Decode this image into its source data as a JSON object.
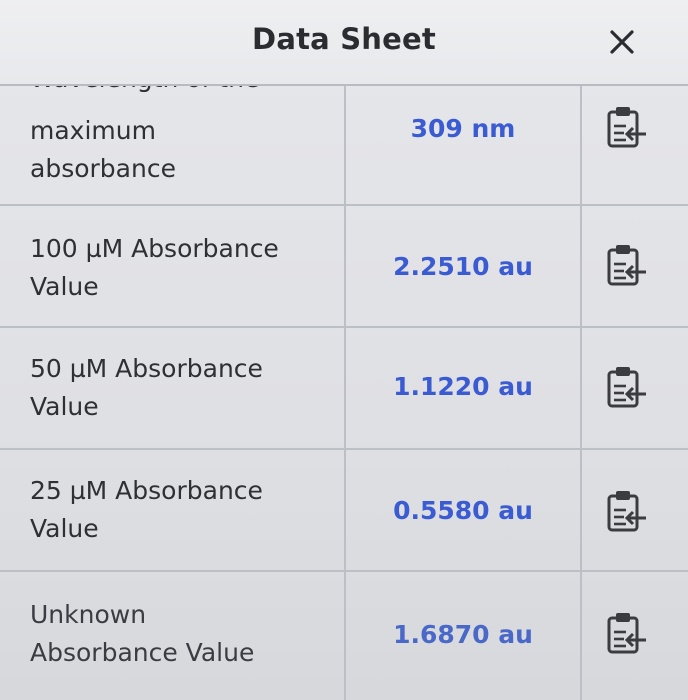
{
  "header": {
    "title": "Data Sheet",
    "close_icon": "close-x-icon"
  },
  "rows": [
    {
      "label_partial": "Wavelength of the",
      "label_line1": "maximum",
      "label_line2": "absorbance",
      "value": "309 nm",
      "icon": "copy-to-clipboard-icon"
    },
    {
      "label_line1": "100 µM Absorbance",
      "label_line2": "Value",
      "value": "2.2510 au",
      "icon": "copy-to-clipboard-icon"
    },
    {
      "label_line1": "50 µM Absorbance",
      "label_line2": "Value",
      "value": "1.1220 au",
      "icon": "copy-to-clipboard-icon"
    },
    {
      "label_line1": "25 µM Absorbance",
      "label_line2": "Value",
      "value": "0.5580 au",
      "icon": "copy-to-clipboard-icon"
    },
    {
      "label_line1": "Unknown",
      "label_line2": "Absorbance Value",
      "value": "1.6870 au",
      "icon": "copy-to-clipboard-icon"
    }
  ],
  "colors": {
    "value_text": "#3b5bd2",
    "label_text": "#2e3034",
    "grid_line": "#bcc0c6"
  }
}
